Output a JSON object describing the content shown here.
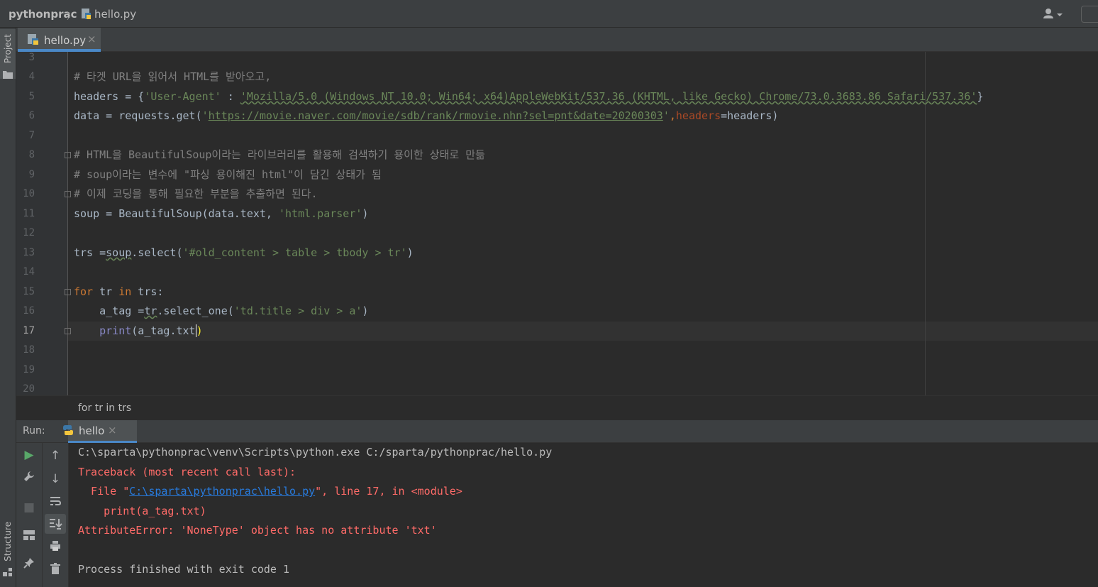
{
  "breadcrumb": {
    "project": "pythonprac",
    "separator": "〉",
    "file": "hello.py"
  },
  "toolbar": {
    "user_icon": "user-icon"
  },
  "side_tools": {
    "project": "Project",
    "structure": "Structure"
  },
  "editor_tab": {
    "label": "hello.py",
    "close": "×"
  },
  "editor": {
    "line_numbers": [
      "3",
      "4",
      "5",
      "6",
      "7",
      "8",
      "9",
      "10",
      "11",
      "12",
      "13",
      "14",
      "15",
      "16",
      "17",
      "18",
      "19",
      "20"
    ],
    "current_line": "17",
    "line4": "# 타겟 URL을 읽어서 HTML를 받아오고,",
    "line5": {
      "a": "headers = {",
      "b": "'User-Agent'",
      "c": " : ",
      "d": "'Mozilla/5.0 (Windows NT 10.0; Win64; x64)AppleWebKit/537.36 (KHTML, like Gecko) Chrome/73.0.3683.86 Safari/537.36'",
      "e": "}"
    },
    "line6": {
      "a": "data = requests.get(",
      "b": "'",
      "url": "https://movie.naver.com/movie/sdb/rank/rmovie.nhn?sel=pnt&date=20200303",
      "c": "'",
      "d": ",",
      "e": "headers",
      "f": "=headers)"
    },
    "line8": "# HTML을 BeautifulSoup이라는 라이브러리를 활용해 검색하기 용이한 상태로 만듦",
    "line9": "# soup이라는 변수에 \"파싱 용이해진 html\"이 담긴 상태가 됨",
    "line10": "# 이제 코딩을 통해 필요한 부분을 추출하면 된다.",
    "line11": {
      "a": "soup = BeautifulSoup(data.text, ",
      "b": "'html.parser'",
      "c": ")"
    },
    "line13": {
      "a": "trs =",
      "b": "soup",
      "c": ".select(",
      "d": "'#old_content > table > tbody > tr'",
      "e": ")"
    },
    "line15": {
      "a": "for",
      "b": " tr ",
      "c": "in",
      "d": " trs:"
    },
    "line16": {
      "a": "    a_tag =",
      "b": "tr",
      "c": ".select_one(",
      "d": "'td.title > div > a'",
      "e": ")"
    },
    "line17": {
      "a": "    ",
      "b": "print",
      "c": "(a_tag.txt",
      "d": ")"
    }
  },
  "status": {
    "breadcrumb": "for tr in trs"
  },
  "run_panel": {
    "label": "Run:",
    "tab": "hello",
    "close": "×"
  },
  "console": {
    "line1": "C:\\sparta\\pythonprac\\venv\\Scripts\\python.exe C:/sparta/pythonprac/hello.py",
    "line2": "Traceback (most recent call last):",
    "line3": {
      "a": "  File \"",
      "link": "C:\\sparta\\pythonprac\\hello.py",
      "b": "\", line 17, in <module>"
    },
    "line4": "    print(a_tag.txt)",
    "line5": "AttributeError: 'NoneType' object has no attribute 'txt'",
    "line6": "Process finished with exit code 1"
  },
  "colors": {
    "accent": "#4a88c7",
    "error": "#ff6b68",
    "link": "#287bde",
    "string": "#6a8759",
    "keyword": "#cc7832",
    "comment": "#808080"
  }
}
